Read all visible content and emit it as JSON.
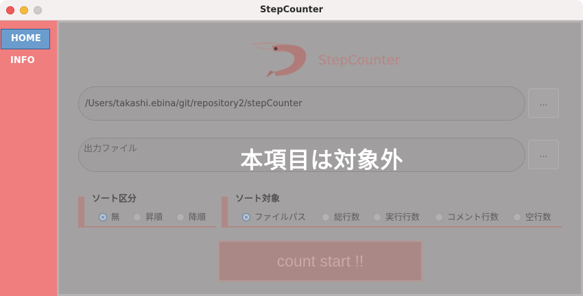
{
  "window": {
    "title": "StepCounter"
  },
  "sidebar": {
    "items": [
      {
        "label": "HOME",
        "active": true
      },
      {
        "label": "INFO",
        "active": false
      }
    ]
  },
  "main": {
    "logo": {
      "icon": "shrimp-logo-icon",
      "text": "StepCounter"
    },
    "path_field": {
      "value": "/Users/takashi.ebina/git/repository2/stepCounter"
    },
    "path_browse_label": "...",
    "output_field": {
      "placeholder": "出力ファイル"
    },
    "output_browse_label": "...",
    "overlay_notice": "本項目は対象外",
    "sort_group": {
      "title": "ソート区分",
      "options": [
        "無",
        "昇順",
        "降順"
      ],
      "selected": "無"
    },
    "sort_target": {
      "title": "ソート対象",
      "options": [
        "ファイルパス",
        "総行数",
        "実行行数",
        "コメント行数",
        "空行数"
      ],
      "selected": "ファイルパス"
    },
    "start_button": "count start !!"
  },
  "colors": {
    "sidebar": "#f07e7e",
    "nav_active": "#6a9ccd",
    "overlay_panel": "#a3a1a1"
  }
}
